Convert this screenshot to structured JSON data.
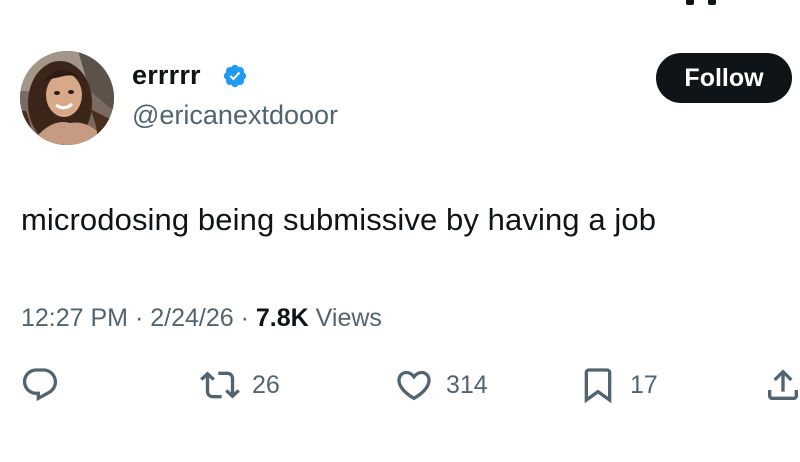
{
  "tweet": {
    "display_name": "errrrr",
    "handle": "@ericanextdooor",
    "verified": true,
    "follow_label": "Follow",
    "text": "microdosing being submissive by having a job",
    "time": "12:27 PM",
    "date": "2/24/26",
    "separator": "·",
    "views_count": "7.8K",
    "views_label": "Views"
  },
  "actions": {
    "reply": {
      "icon": "reply-icon"
    },
    "repost": {
      "icon": "repost-icon",
      "count": "26"
    },
    "like": {
      "icon": "heart-icon",
      "count": "314"
    },
    "bookmark": {
      "icon": "bookmark-icon",
      "count": "17"
    },
    "share": {
      "icon": "share-icon"
    }
  },
  "colors": {
    "text": "#0f1419",
    "secondary": "#536471",
    "verified_badge": "#1d9bf0",
    "follow_button_bg": "#0f1419",
    "follow_button_text": "#ffffff"
  }
}
